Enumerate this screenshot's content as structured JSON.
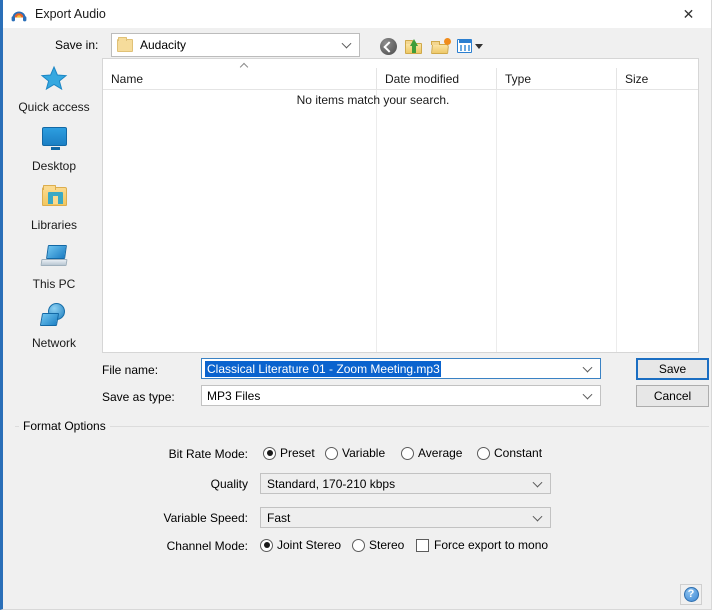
{
  "window": {
    "title": "Export Audio",
    "icon": "audacity-headphones-icon",
    "close_label": "✕",
    "accent_color": "#2a6fb8"
  },
  "savein": {
    "label": "Save in:",
    "value": "Audacity",
    "folder_icon": "folder-icon",
    "dropdown_icon": "chevron-down-icon"
  },
  "toolbar": {
    "back": "back-icon",
    "up_one_level": "up-one-level-icon",
    "new_folder": "new-folder-icon",
    "views": "views-icon",
    "views_dropdown": "chevron-down-icon"
  },
  "places": {
    "items": [
      {
        "label": "Quick access",
        "icon": "quick-access-star-icon"
      },
      {
        "label": "Desktop",
        "icon": "desktop-monitor-icon"
      },
      {
        "label": "Libraries",
        "icon": "libraries-folder-icon"
      },
      {
        "label": "This PC",
        "icon": "this-pc-icon"
      },
      {
        "label": "Network",
        "icon": "network-icon"
      }
    ]
  },
  "filelist": {
    "columns": [
      "Name",
      "Date modified",
      "Type",
      "Size"
    ],
    "rows": [],
    "empty_message": "No items match your search.",
    "sort_indicator": "sort-ascending-icon"
  },
  "filename": {
    "label": "File name:",
    "value": "Classical Literature 01 - Zoom Meeting.mp3",
    "selected": true,
    "selection_color": "#0a63ce"
  },
  "savetype": {
    "label": "Save as type:",
    "value": "MP3 Files"
  },
  "buttons": {
    "save": "Save",
    "cancel": "Cancel",
    "help": "?"
  },
  "format_options": {
    "legend": "Format Options",
    "bitrate": {
      "label": "Bit Rate Mode:",
      "options": [
        "Preset",
        "Variable",
        "Average",
        "Constant"
      ],
      "selected": "Preset"
    },
    "quality": {
      "label": "Quality",
      "value": "Standard, 170-210 kbps"
    },
    "variable_speed": {
      "label": "Variable Speed:",
      "value": "Fast"
    },
    "channel_mode": {
      "label": "Channel Mode:",
      "options": [
        "Joint Stereo",
        "Stereo"
      ],
      "selected": "Joint Stereo",
      "force_mono_label": "Force export to mono",
      "force_mono_checked": false
    }
  }
}
